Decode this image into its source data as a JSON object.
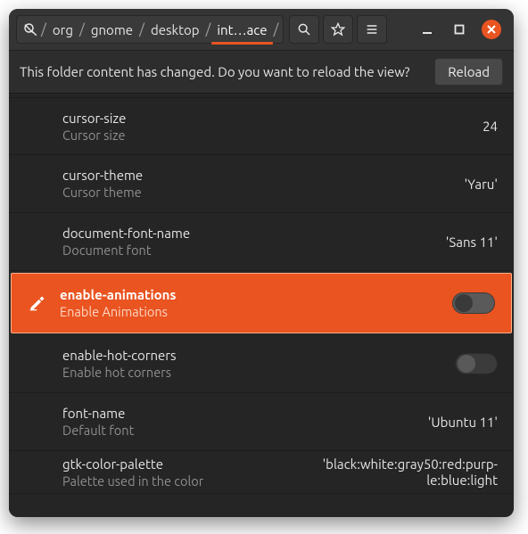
{
  "breadcrumb": {
    "segments": [
      "org",
      "gnome",
      "desktop",
      "int…ace"
    ],
    "separator": "/"
  },
  "infobar": {
    "message": "This folder content has changed. Do you want to reload the view?",
    "reload_label": "Reload"
  },
  "rows": [
    {
      "key": "cursor-size",
      "desc": "Cursor size",
      "value": "24",
      "type": "text"
    },
    {
      "key": "cursor-theme",
      "desc": "Cursor theme",
      "value": "'Yaru'",
      "type": "text"
    },
    {
      "key": "document-font-name",
      "desc": "Document font",
      "value": "'Sans 11'",
      "type": "text"
    },
    {
      "key": "enable-animations",
      "desc": "Enable Animations",
      "value": false,
      "type": "toggle",
      "selected": true
    },
    {
      "key": "enable-hot-corners",
      "desc": "Enable hot corners",
      "value": false,
      "type": "toggle"
    },
    {
      "key": "font-name",
      "desc": "Default font",
      "value": "'Ubuntu 11'",
      "type": "text"
    },
    {
      "key": "gtk-color-palette",
      "desc": "Palette used in the color",
      "value": "'black:white:gray50:red:purp-\nle:blue:light",
      "type": "text"
    }
  ],
  "colors": {
    "accent": "#e95420"
  }
}
